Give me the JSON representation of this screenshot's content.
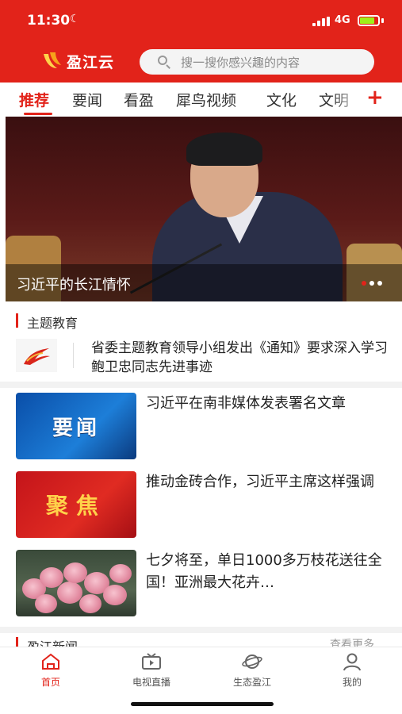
{
  "status_bar": {
    "time": "11:30",
    "network": "4G"
  },
  "header": {
    "brand_name": "盈江云",
    "search_placeholder": "搜一搜你感兴趣的内容"
  },
  "tabs": [
    {
      "label": "推荐",
      "active": true
    },
    {
      "label": "要闻"
    },
    {
      "label": "看盈"
    },
    {
      "label": "犀鸟视频"
    },
    {
      "label": "文化"
    },
    {
      "label": "文明"
    }
  ],
  "hero": {
    "caption": "习近平的长江情怀",
    "slide_index": 1,
    "slide_count": 2
  },
  "section_topic": {
    "title": "主题教育",
    "item": {
      "text": "省委主题教育领导小组发出《通知》要求深入学习鲍卫忠同志先进事迹"
    }
  },
  "news": [
    {
      "thumb_text": "要闻",
      "title": "习近平在南非媒体发表署名文章"
    },
    {
      "thumb_text": "聚焦",
      "title": "推动金砖合作，习近平主席这样强调"
    },
    {
      "thumb_text": "",
      "title": "七夕将至，单日1000多万枝花送往全国！亚洲最大花卉…"
    }
  ],
  "section_local": {
    "title": "盈江新闻",
    "more": "查看更多"
  },
  "bottom_nav": [
    {
      "label": "首页",
      "icon": "home-icon",
      "active": true
    },
    {
      "label": "电视直播",
      "icon": "tv-icon"
    },
    {
      "label": "生态盈江",
      "icon": "planet-icon"
    },
    {
      "label": "我的",
      "icon": "user-icon"
    }
  ],
  "colors": {
    "brand_red": "#e2231a",
    "battery": "#9ef01a"
  }
}
